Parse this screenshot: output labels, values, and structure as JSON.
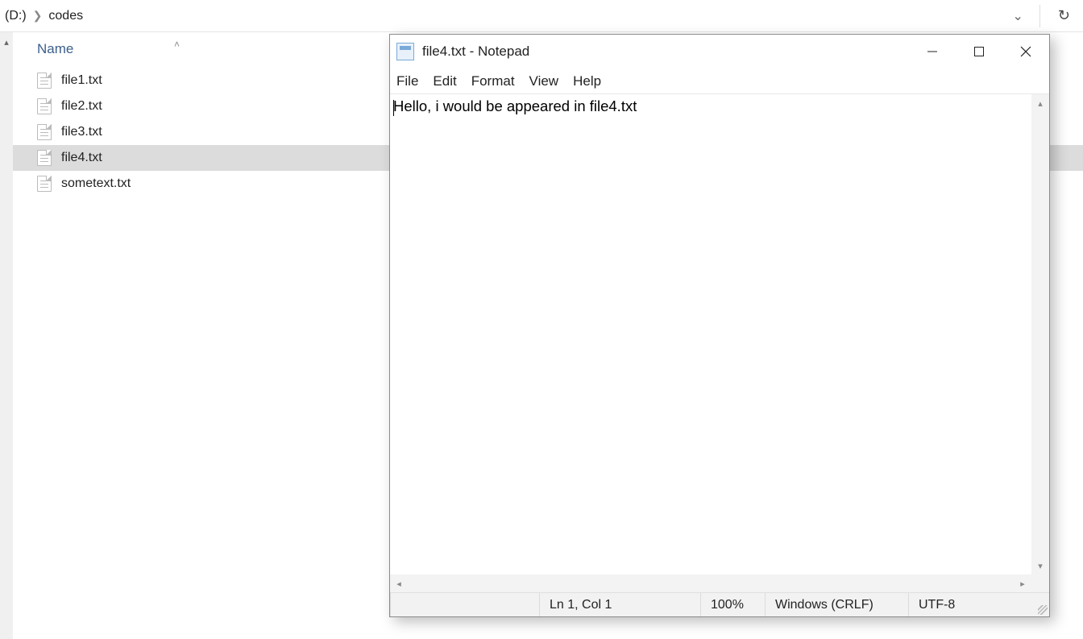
{
  "explorer": {
    "breadcrumb": {
      "drive": "(D:)",
      "folder": "codes"
    },
    "column_header": "Name",
    "files": [
      {
        "name": "file1.txt",
        "selected": false
      },
      {
        "name": "file2.txt",
        "selected": false
      },
      {
        "name": "file3.txt",
        "selected": false
      },
      {
        "name": "file4.txt",
        "selected": true
      },
      {
        "name": "sometext.txt",
        "selected": false
      }
    ]
  },
  "notepad": {
    "title": "file4.txt - Notepad",
    "menu": {
      "file": "File",
      "edit": "Edit",
      "format": "Format",
      "view": "View",
      "help": "Help"
    },
    "content": "Hello, i would be appeared in file4.txt",
    "status": {
      "position": "Ln 1, Col 1",
      "zoom": "100%",
      "line_ending": "Windows (CRLF)",
      "encoding": "UTF-8"
    }
  }
}
